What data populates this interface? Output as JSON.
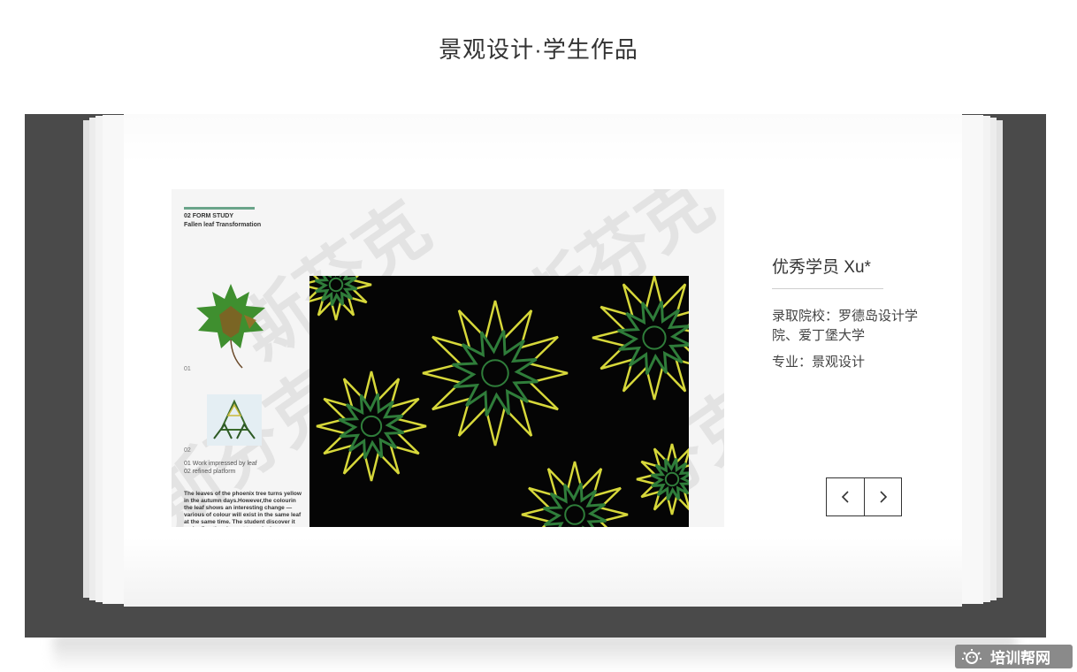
{
  "header": {
    "title": "景观设计·学生作品"
  },
  "artwork": {
    "heading": "02 FORM STUDY",
    "subheading": "Fallen leaf Transformation",
    "label_01": "01",
    "label_02": "02",
    "work_line_1": "01 Work impressed by leaf",
    "work_line_2": "02 refined platform",
    "description": "The leaves of the phoenix tree turns yellow in the autumn days.However,the colourin the leaf shows an interesting change — various of colour will exist in the same leaf at the same time. The student discover it and refine the element to make her own work.",
    "watermark": "斯芬克",
    "colors": {
      "background": "#050505",
      "green": "#2f7d3a",
      "yellow": "#d7d83a"
    }
  },
  "student": {
    "name": "优秀学员 Xu*",
    "school": "录取院校：罗德岛设计学院、爱丁堡大学",
    "major": "专业：景观设计"
  },
  "navigation": {
    "prev_icon": "chevron-left-icon",
    "next_icon": "chevron-right-icon"
  },
  "brand": {
    "label": "培训帮网",
    "icon": "sun-face-icon"
  },
  "colors": {
    "frame": "#4a4a4a",
    "card": "#ffffff",
    "text": "#333333"
  }
}
